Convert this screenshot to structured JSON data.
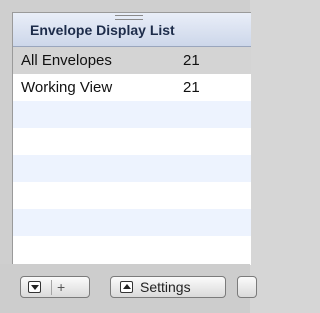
{
  "panel": {
    "title": "Envelope Display List"
  },
  "rows": [
    {
      "name": "All Envelopes",
      "count": "21"
    },
    {
      "name": "Working View",
      "count": "21"
    }
  ],
  "toolbar": {
    "menu_icon": "chevron-down-icon",
    "add_label": "+",
    "settings_icon": "chevron-up-icon",
    "settings_label": "Settings"
  },
  "colors": {
    "header_top": "#e9eef8",
    "header_bottom": "#cdd7ea",
    "selected_row": "#d4d4d4",
    "alt_row": "#edf3fe"
  }
}
